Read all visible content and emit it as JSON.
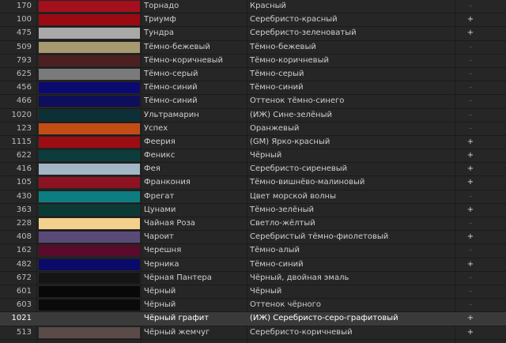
{
  "rows": [
    {
      "code": "170",
      "color": "#a30f1c",
      "name": "Торнадо",
      "desc": "Красный",
      "mark": "–"
    },
    {
      "code": "100",
      "color": "#9a0a12",
      "name": "Триумф",
      "desc": "Серебристо-красный",
      "mark": "+"
    },
    {
      "code": "475",
      "color": "#a9a9a9",
      "name": "Тундра",
      "desc": "Серебристо-зеленоватый",
      "mark": "+"
    },
    {
      "code": "509",
      "color": "#a79a70",
      "name": "Тёмно-бежевый",
      "desc": "Тёмно-бежевый",
      "mark": "–"
    },
    {
      "code": "793",
      "color": "#4c2021",
      "name": "Тёмно-коричневый",
      "desc": "Тёмно-коричневый",
      "mark": "–"
    },
    {
      "code": "625",
      "color": "#7a7a7a",
      "name": "Тёмно-серый",
      "desc": "Тёмно-серый",
      "mark": "–"
    },
    {
      "code": "456",
      "color": "#0a0a70",
      "name": "Тёмно-синий",
      "desc": "Тёмно-синий",
      "mark": "–"
    },
    {
      "code": "466",
      "color": "#0e0e5a",
      "name": "Тёмно-синий",
      "desc": "Оттенок тёмно-синего",
      "mark": "–"
    },
    {
      "code": "1020",
      "color": "#0c3038",
      "name": "Ультрамарин",
      "desc": "(ИЖ) Сине-зелёный",
      "mark": "–"
    },
    {
      "code": "123",
      "color": "#c24d14",
      "name": "Успех",
      "desc": "Оранжевый",
      "mark": "–"
    },
    {
      "code": "1115",
      "color": "#9b0d12",
      "name": "Феерия",
      "desc": "(GM) Ярко-красный",
      "mark": "+"
    },
    {
      "code": "622",
      "color": "#0c3c3c",
      "name": "Феникс",
      "desc": "Чёрный",
      "mark": "+"
    },
    {
      "code": "416",
      "color": "#a3b6c6",
      "name": "Фея",
      "desc": "Серебристо-сиреневый",
      "mark": "+"
    },
    {
      "code": "105",
      "color": "#8d1322",
      "name": "Франкония",
      "desc": "Тёмно-вишнёво-малиновый",
      "mark": "+"
    },
    {
      "code": "430",
      "color": "#0e7d82",
      "name": "Фрегат",
      "desc": "Цвет морской волны",
      "mark": "–"
    },
    {
      "code": "363",
      "color": "#0b3a34",
      "name": "Цунами",
      "desc": "Тёмно-зелёный",
      "mark": "+"
    },
    {
      "code": "228",
      "color": "#f3d08c",
      "name": "Чайная Роза",
      "desc": "Светло-жёлтый",
      "mark": "–"
    },
    {
      "code": "408",
      "color": "#5a4a78",
      "name": "Чароит",
      "desc": "Серебристый тёмно-фиолетовый",
      "mark": "+"
    },
    {
      "code": "162",
      "color": "#5a0a2a",
      "name": "Черешня",
      "desc": "Тёмно-алый",
      "mark": "–"
    },
    {
      "code": "482",
      "color": "#0a0a6a",
      "name": "Черника",
      "desc": "Тёмно-синий",
      "mark": "+"
    },
    {
      "code": "672",
      "color": "#151515",
      "name": "Чёрная Пантера",
      "desc": "Чёрный, двойная эмаль",
      "mark": "–"
    },
    {
      "code": "601",
      "color": "#080808",
      "name": "Чёрный",
      "desc": "Чёрный",
      "mark": "–"
    },
    {
      "code": "603",
      "color": "#0a0a0a",
      "name": "Чёрный",
      "desc": "Оттенок чёрного",
      "mark": "–"
    },
    {
      "code": "1021",
      "color": "#3a3a3a",
      "name": "Чёрный графит",
      "desc": "(ИЖ) Серебристо-серо-графитовый",
      "mark": "+",
      "selected": true
    },
    {
      "code": "513",
      "color": "#5a4b48",
      "name": "Чёрный жемчуг",
      "desc": "Серебристо-коричневый",
      "mark": "+"
    }
  ]
}
